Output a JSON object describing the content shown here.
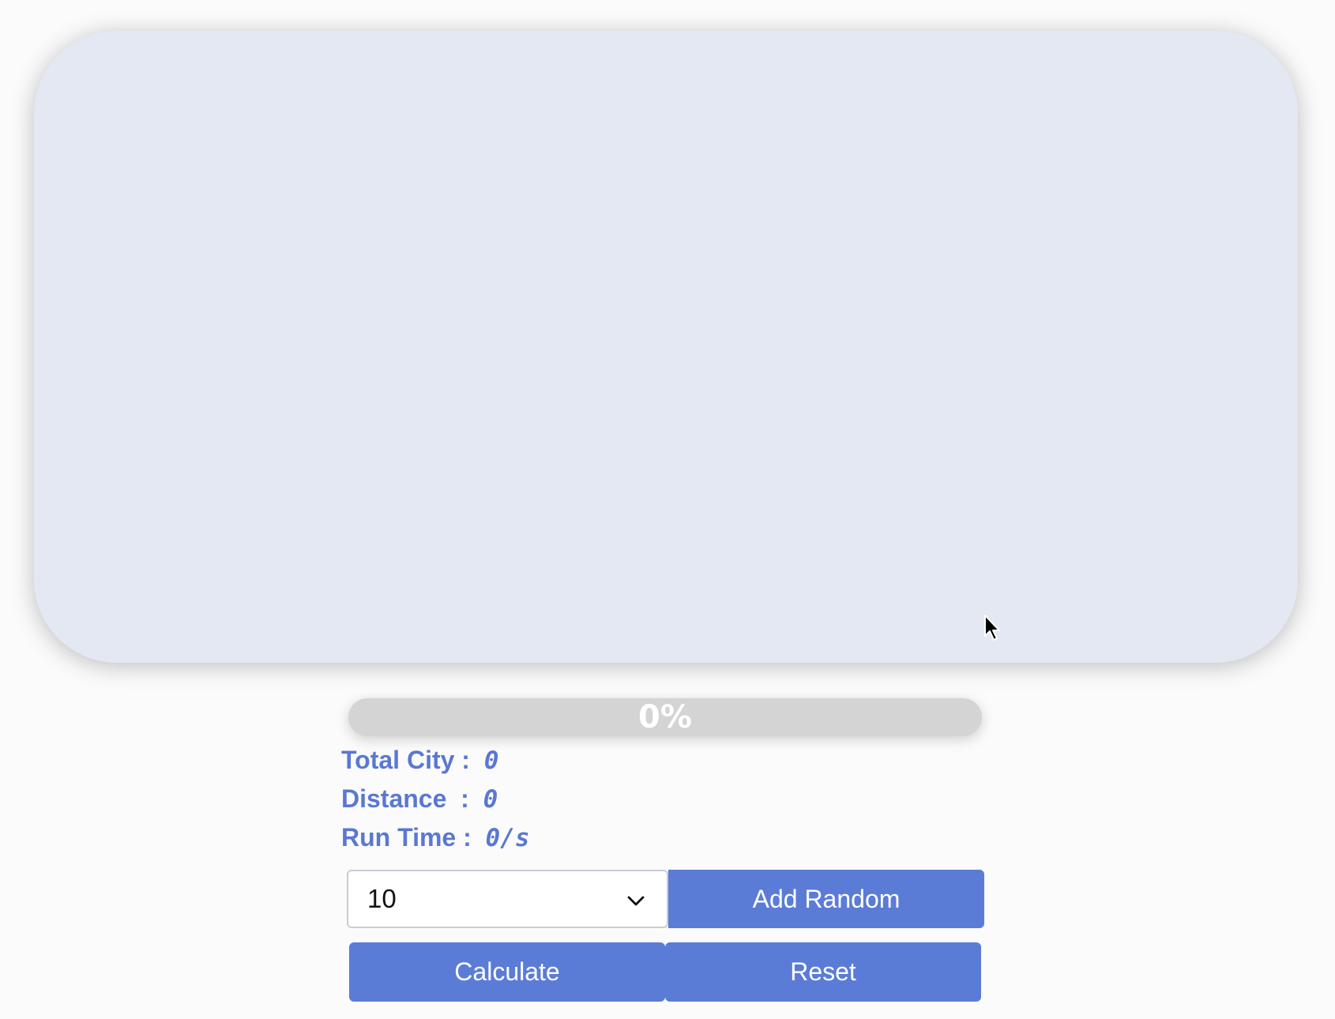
{
  "progress": {
    "text": "0%",
    "fraction": 0
  },
  "stats": {
    "total_city_label": "Total City :  ",
    "total_city_value": "0",
    "distance_label": "Distance  :  ",
    "distance_value": "0",
    "run_time_label": "Run Time :  ",
    "run_time_value": "0/s"
  },
  "controls": {
    "city_count_selected": "10",
    "add_random_label": "Add Random",
    "calculate_label": "Calculate",
    "reset_label": "Reset"
  },
  "colors": {
    "accent": "#5b7cd6",
    "canvas_bg": "#e4e8f3",
    "progress_track": "#d4d4d4"
  },
  "icons": {
    "select_arrow": "chevron-down-icon",
    "pointer": "mouse-cursor-icon"
  }
}
